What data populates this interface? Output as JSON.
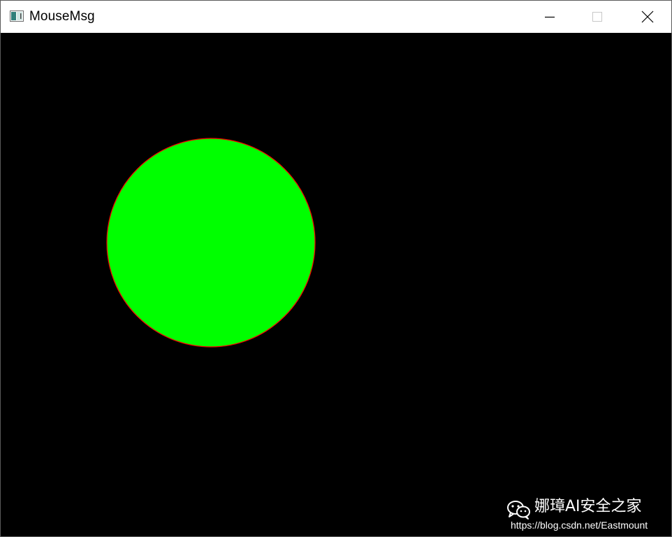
{
  "window": {
    "title": "MouseMsg",
    "icon": "app-window-icon",
    "controls": {
      "minimize_icon": "minimize-icon",
      "maximize_icon": "maximize-icon",
      "close_icon": "close-icon"
    }
  },
  "canvas": {
    "background": "#000000",
    "shape": "circle",
    "fill_color": "#00ff00",
    "outline_color": "#ff0000"
  },
  "watermark": {
    "icon": "wechat-icon",
    "title": "娜璋AI安全之家",
    "url": "https://blog.csdn.net/Eastmount"
  }
}
